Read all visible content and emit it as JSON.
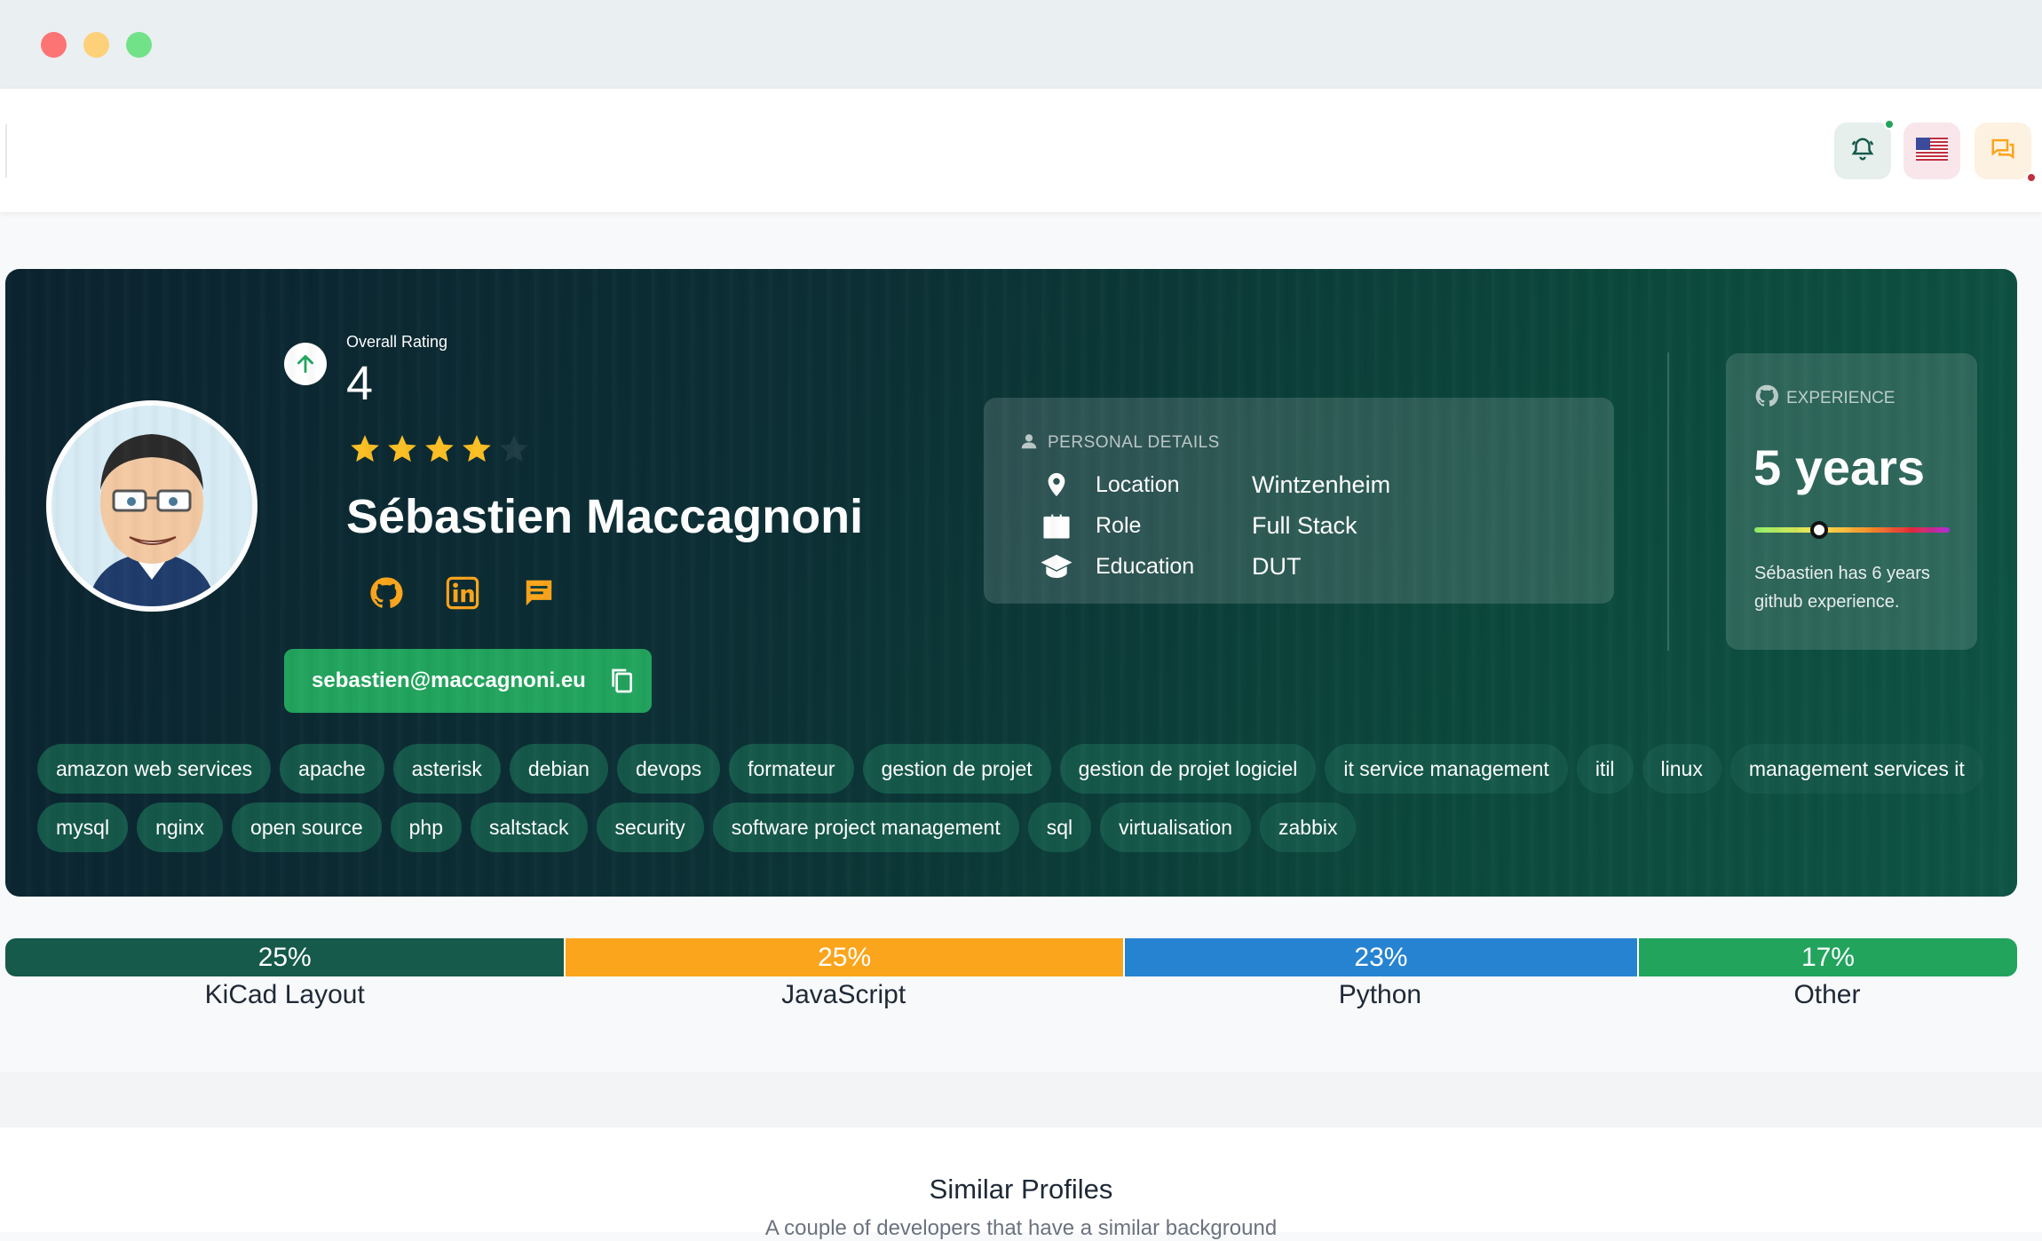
{
  "window": {
    "controls": [
      "close",
      "minimize",
      "maximize"
    ]
  },
  "header": {
    "icons": [
      "bell-icon",
      "us-flag-icon",
      "chat-icon"
    ]
  },
  "profile": {
    "rating_label": "Overall Rating",
    "rating_value": "4",
    "stars": 4,
    "star_max": 5,
    "name": "Sébastien Maccagnoni",
    "email": "sebastien@maccagnoni.eu",
    "socials": [
      "github-icon",
      "linkedin-icon",
      "message-icon"
    ]
  },
  "personal_details": {
    "title": "PERSONAL DETAILS",
    "rows": [
      {
        "label": "Location",
        "value": "Wintzenheim",
        "icon": "location-pin-icon"
      },
      {
        "label": "Role",
        "value": "Full Stack",
        "icon": "briefcase-icon"
      },
      {
        "label": "Education",
        "value": "DUT",
        "icon": "graduation-cap-icon"
      }
    ]
  },
  "experience": {
    "title": "EXPERIENCE",
    "value": "5 years",
    "level_fraction": 0.33,
    "description": "Sébastien has 6 years github experience."
  },
  "tags": [
    "amazon web services",
    "apache",
    "asterisk",
    "debian",
    "devops",
    "formateur",
    "gestion de projet",
    "gestion de projet logiciel",
    "it service management",
    "itil",
    "linux",
    "management services it",
    "mysql",
    "nginx",
    "open source",
    "php",
    "saltstack",
    "security",
    "software project management",
    "sql",
    "virtualisation",
    "zabbix"
  ],
  "languages": [
    {
      "name": "KiCad Layout",
      "percent_label": "25%",
      "share": 25,
      "color": "#155a4b"
    },
    {
      "name": "JavaScript",
      "percent_label": "25%",
      "share": 25,
      "color": "#fba51c"
    },
    {
      "name": "Python",
      "percent_label": "23%",
      "share": 23,
      "color": "#2683d1"
    },
    {
      "name": "Other",
      "percent_label": "17%",
      "share": 17,
      "color": "#22a45d"
    }
  ],
  "similar": {
    "title": "Similar Profiles",
    "subtitle": "A couple of developers that have a similar background"
  }
}
